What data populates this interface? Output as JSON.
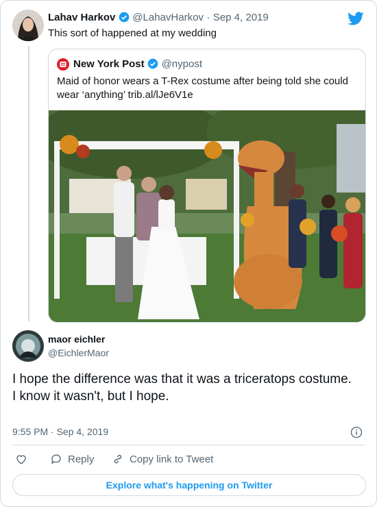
{
  "colors": {
    "twitter_blue": "#1d9bf0",
    "muted": "#536471",
    "border": "#cfd9de",
    "nypost_red": "#e11d2b"
  },
  "original_tweet": {
    "author_name": "Lahav Harkov",
    "author_handle": "@LahavHarkov",
    "separator": "·",
    "date": "Sep 4, 2019",
    "text": "This sort of happened at my wedding"
  },
  "quoted_tweet": {
    "author_name": "New York Post",
    "author_handle": "@nypost",
    "text": "Maid of honor wears a T-Rex costume after being told she could wear ‘anything’ trib.al/lJe6V1e"
  },
  "reply": {
    "author_name": "maor eichler",
    "author_handle": "@EichlerMaor",
    "text_line1": "I hope the difference was that it was a triceratops costume.",
    "text_line2": "I know it wasn't, but I hope.",
    "time": "9:55 PM",
    "separator": "·",
    "date": "Sep 4, 2019"
  },
  "actions": {
    "reply_label": "Reply",
    "copy_label": "Copy link to Tweet"
  },
  "footer": {
    "explore_label": "Explore what's happening on Twitter"
  },
  "icons": [
    "twitter-logo",
    "verified-badge",
    "heart-icon",
    "reply-icon",
    "link-icon",
    "info-icon"
  ]
}
